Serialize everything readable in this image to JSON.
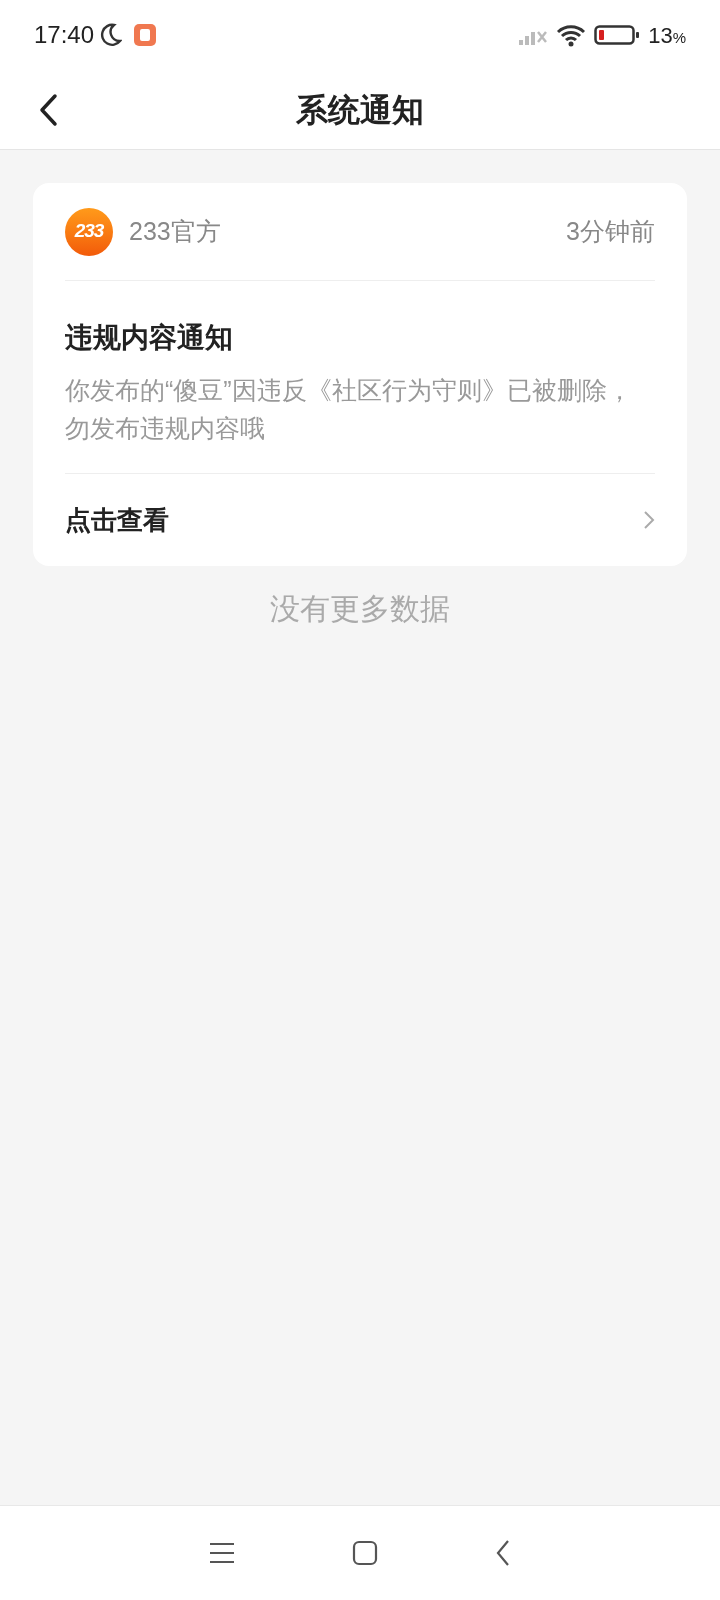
{
  "status_bar": {
    "time": "17:40",
    "battery_percent": "13",
    "battery_unit": "%"
  },
  "header": {
    "title": "系统通知"
  },
  "notifications": [
    {
      "avatar_text": "233",
      "sender": "233官方",
      "time": "3分钟前",
      "title": "违规内容通知",
      "body": "你发布的“傻豆”因违反《社区行为守则》已被删除，勿发布违规内容哦",
      "action": "点击查看"
    }
  ],
  "footer_text": "没有更多数据"
}
